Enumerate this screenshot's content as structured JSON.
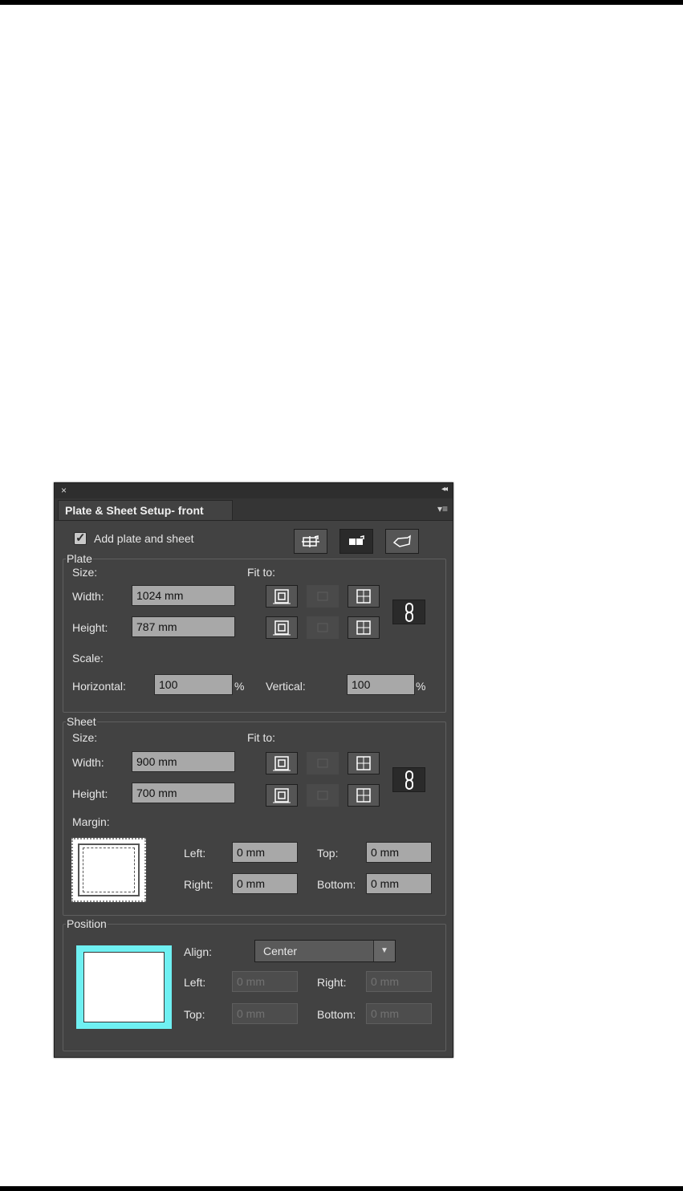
{
  "panel": {
    "tab_title": "Plate & Sheet Setup- front",
    "close_glyph": "×",
    "collapse_glyph": "◂◂",
    "menu_glyph": "▾≡"
  },
  "top": {
    "add_plate_label": "Add plate and sheet",
    "add_plate_checked": true
  },
  "plate": {
    "legend": "Plate",
    "size_label": "Size:",
    "fit_to_label": "Fit to:",
    "width_label": "Width:",
    "width_value": "1024 mm",
    "height_label": "Height:",
    "height_value": "787 mm",
    "scale_label": "Scale:",
    "horizontal_label": "Horizontal:",
    "horizontal_value": "100",
    "vertical_label": "Vertical:",
    "vertical_value": "100",
    "percent": "%"
  },
  "sheet": {
    "legend": "Sheet",
    "size_label": "Size:",
    "fit_to_label": "Fit to:",
    "width_label": "Width:",
    "width_value": "900 mm",
    "height_label": "Height:",
    "height_value": "700 mm",
    "margin_label": "Margin:",
    "left_label": "Left:",
    "left_value": "0 mm",
    "top_label": "Top:",
    "top_value": "0 mm",
    "right_label": "Right:",
    "right_value": "0 mm",
    "bottom_label": "Bottom:",
    "bottom_value": "0 mm"
  },
  "position": {
    "legend": "Position",
    "align_label": "Align:",
    "align_value": "Center",
    "left_label": "Left:",
    "left_value": "0 mm",
    "right_label": "Right:",
    "right_value": "0 mm",
    "top_label": "Top:",
    "top_value": "0 mm",
    "bottom_label": "Bottom:",
    "bottom_value": "0 mm"
  },
  "colors": {
    "panel_bg": "#424242",
    "preview_accent": "#6ff0f2"
  }
}
